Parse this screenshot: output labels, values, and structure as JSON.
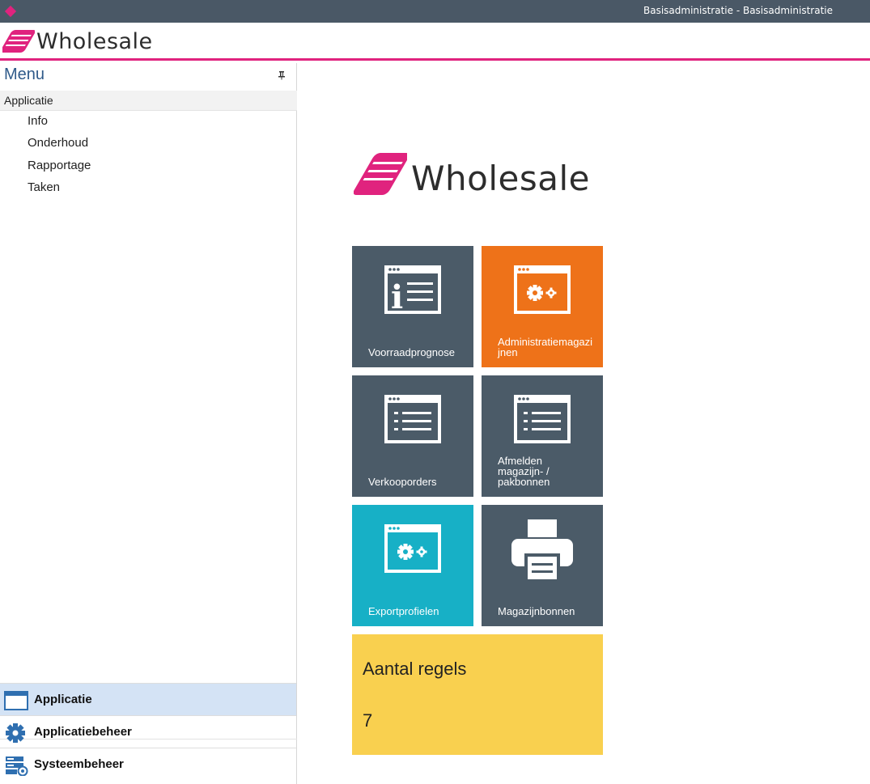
{
  "window": {
    "title": "Basisadministratie - Basisadministratie"
  },
  "header": {
    "logo_text": "Wholesale"
  },
  "sidebar": {
    "menu_title": "Menu",
    "pin_icon": "pin-icon",
    "section_title": "Applicatie",
    "items": [
      {
        "label": "Info"
      },
      {
        "label": "Onderhoud"
      },
      {
        "label": "Rapportage"
      },
      {
        "label": "Taken"
      }
    ],
    "nav": [
      {
        "label": "Applicatie",
        "icon": "window-icon",
        "active": true
      },
      {
        "label": "Applicatiebeheer",
        "icon": "gear-icon",
        "active": false
      },
      {
        "label": "Systeembeheer",
        "icon": "server-icon",
        "active": false
      }
    ]
  },
  "main": {
    "logo_text": "Wholesale",
    "tiles": [
      {
        "label": "Voorraadprognose",
        "icon": "info-list-icon",
        "color": "#4b5b68"
      },
      {
        "label": "Administratiemagazijnen",
        "icon": "window-gear-icon",
        "color": "#ee7219"
      },
      {
        "label": "Verkooporders",
        "icon": "window-list-icon",
        "color": "#4b5b68"
      },
      {
        "label": "Afmelden magazijn- / pakbonnen",
        "icon": "window-list-icon",
        "color": "#4b5b68"
      },
      {
        "label": "Exportprofielen",
        "icon": "window-gear-icon",
        "color": "#17b0c6"
      },
      {
        "label": "Magazijnbonnen",
        "icon": "printer-icon",
        "color": "#4b5b68"
      }
    ],
    "kpi": {
      "title": "Aantal regels",
      "value": "7",
      "color": "#f9d04f"
    }
  },
  "colors": {
    "accent": "#e0237e",
    "titlebar": "#4a5866",
    "menu_title": "#2f5a8a",
    "nav_active": "#d4e3f5"
  }
}
